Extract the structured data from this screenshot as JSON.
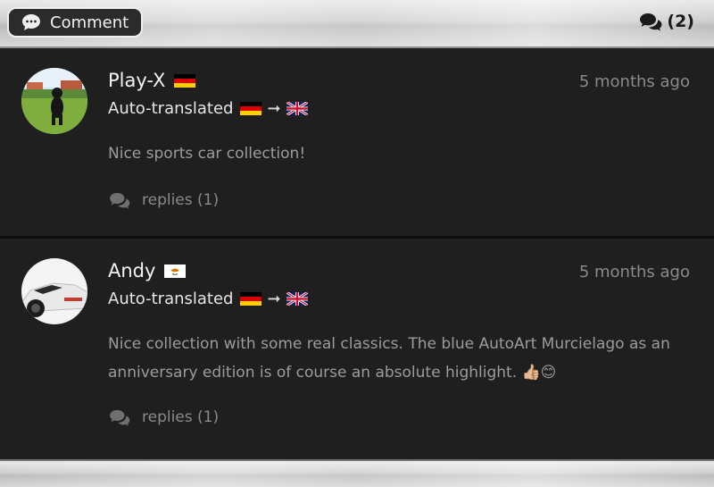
{
  "header": {
    "comment_button_label": "Comment",
    "comment_count": "(2)"
  },
  "comments": [
    {
      "author": "Play-X",
      "author_flag": "de",
      "time": "5 months ago",
      "auto_translated_label": "Auto-translated",
      "translation_from": "de",
      "translation_to": "gb",
      "text": "Nice sports car collection!",
      "replies_label": "replies (1)"
    },
    {
      "author": "Andy",
      "author_flag": "cy",
      "time": "5 months ago",
      "auto_translated_label": "Auto-translated",
      "translation_from": "de",
      "translation_to": "gb",
      "text": "Nice collection with some real classics. The blue AutoArt Murcielago as an anniversary edition is of course an absolute highlight. 👍🏼😊",
      "replies_label": "replies (1)"
    }
  ],
  "colors": {
    "background": "#1f1f1f",
    "muted_text": "#8a8a8a",
    "body_text": "#9c9c9c"
  }
}
